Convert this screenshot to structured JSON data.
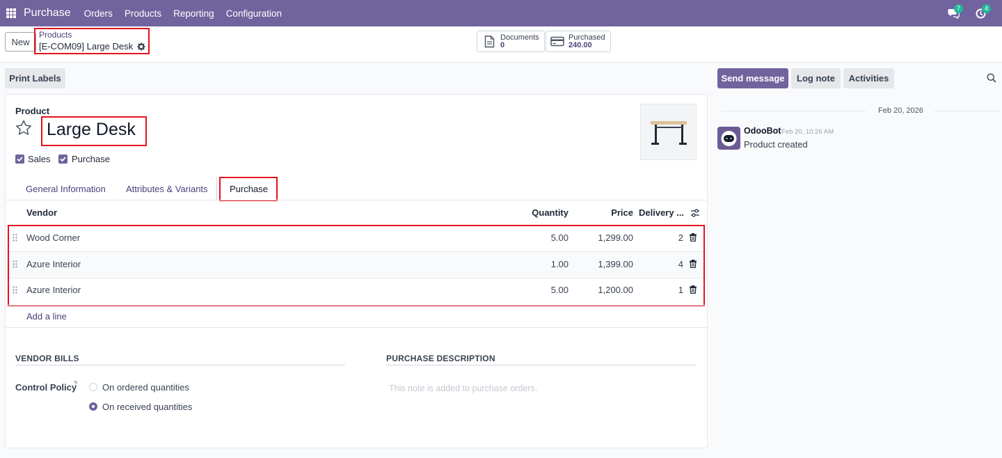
{
  "topbar": {
    "app_name": "Purchase",
    "menu": [
      "Orders",
      "Products",
      "Reporting",
      "Configuration"
    ],
    "messages_count": "7",
    "activities_count": "4",
    "color": "#71639e"
  },
  "control": {
    "new_label": "New",
    "breadcrumb_parent": "Products",
    "breadcrumb_current": "[E-COM09] Large Desk",
    "smart_buttons": [
      {
        "label": "Documents",
        "value": "0",
        "icon": "file-icon"
      },
      {
        "label": "Purchased",
        "value": "240.00",
        "icon": "credit-card-icon"
      }
    ]
  },
  "actions": {
    "print_labels": "Print Labels"
  },
  "form": {
    "product_label": "Product",
    "name": "Large Desk",
    "checkboxes": [
      {
        "label": "Sales",
        "checked": true
      },
      {
        "label": "Purchase",
        "checked": true
      }
    ],
    "tabs": [
      "General Information",
      "Attributes & Variants",
      "Purchase"
    ],
    "active_tab": "Purchase"
  },
  "vendors": {
    "columns": [
      "Vendor",
      "Quantity",
      "Price",
      "Delivery ..."
    ],
    "rows": [
      {
        "vendor": "Wood Corner",
        "quantity": "5.00",
        "price": "1,299.00",
        "delivery": "2"
      },
      {
        "vendor": "Azure Interior",
        "quantity": "1.00",
        "price": "1,399.00",
        "delivery": "4"
      },
      {
        "vendor": "Azure Interior",
        "quantity": "5.00",
        "price": "1,200.00",
        "delivery": "1"
      }
    ],
    "add_line": "Add a line"
  },
  "vendor_bills": {
    "heading": "VENDOR BILLS",
    "control_policy_label": "Control Policy",
    "help_mark": "?",
    "options": [
      {
        "label": "On ordered quantities",
        "selected": false
      },
      {
        "label": "On received quantities",
        "selected": true
      }
    ]
  },
  "purchase_description": {
    "heading": "PURCHASE DESCRIPTION",
    "placeholder": "This note is added to purchase orders."
  },
  "chatter": {
    "send_message": "Send message",
    "log_note": "Log note",
    "activities": "Activities",
    "date_separator": "Feb 20, 2026",
    "messages": [
      {
        "author": "OdooBot",
        "time": "Feb 20, 10:26 AM",
        "body": "Product created"
      }
    ]
  }
}
